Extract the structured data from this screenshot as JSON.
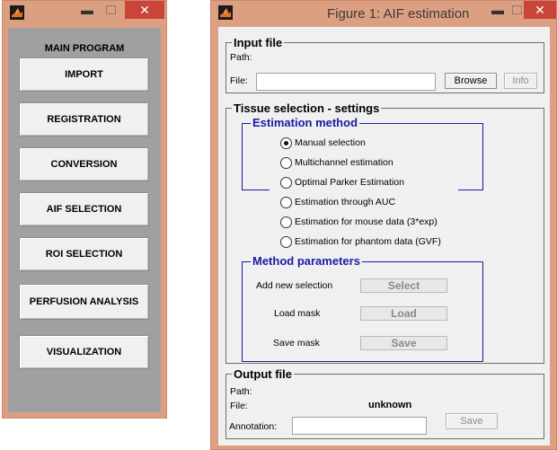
{
  "colors": {
    "window_frame": "#dc9f82",
    "close_button": "#c9453a",
    "main_client": "#a0a0a0",
    "group_title_blue": "#1a1aa6",
    "client": "#f0f0f0"
  },
  "left_window": {
    "title": "",
    "controls": {
      "minimize": "▬",
      "maximize": "",
      "close": "✕"
    },
    "header": "MAIN PROGRAM",
    "buttons": [
      {
        "label": "IMPORT"
      },
      {
        "label": "REGISTRATION"
      },
      {
        "label": "CONVERSION"
      },
      {
        "label": "AIF SELECTION"
      },
      {
        "label": "ROI SELECTION"
      },
      {
        "label": "PERFUSION ANALYSIS"
      },
      {
        "label": "VISUALIZATION"
      }
    ]
  },
  "right_window": {
    "title": "Figure 1: AIF estimation",
    "controls": {
      "minimize": "▬",
      "maximize": "",
      "close": "✕"
    },
    "input_file": {
      "title": "Input file",
      "path_label": "Path:",
      "file_label": "File:",
      "file_value": "",
      "browse_label": "Browse",
      "info_label": "Info"
    },
    "tissue_selection": {
      "title": "Tissue selection - settings",
      "estimation_method": {
        "title": "Estimation method",
        "options": [
          {
            "label": "Manual selection",
            "selected": true
          },
          {
            "label": "Multichannel estimation",
            "selected": false
          },
          {
            "label": "Optimal Parker Estimation",
            "selected": false
          },
          {
            "label": "Estimation through AUC",
            "selected": false
          },
          {
            "label": "Estimation for mouse data (3*exp)",
            "selected": false
          },
          {
            "label": "Estimation for phantom data (GVF)",
            "selected": false
          }
        ]
      },
      "method_parameters": {
        "title": "Method parameters",
        "rows": [
          {
            "label": "Add new selection",
            "button": "Select"
          },
          {
            "label": "Load mask",
            "button": "Load"
          },
          {
            "label": "Save mask",
            "button": "Save"
          }
        ]
      }
    },
    "output_file": {
      "title": "Output file",
      "path_label": "Path:",
      "file_label": "File:",
      "file_value": "unknown",
      "annotation_label": "Annotation:",
      "annotation_value": "",
      "save_label": "Save"
    }
  }
}
